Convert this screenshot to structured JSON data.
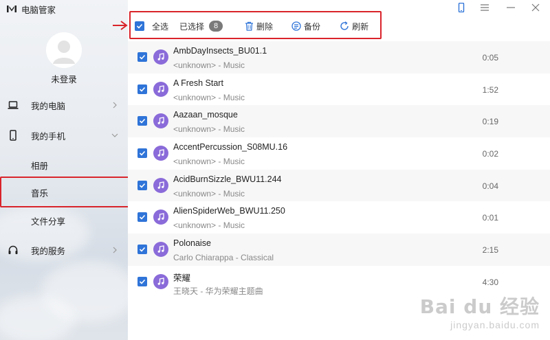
{
  "app": {
    "title": "电脑管家",
    "logo_icon": "app-logo-icon"
  },
  "user": {
    "login_status": "未登录"
  },
  "sidebar": {
    "items": [
      {
        "label": "我的电脑",
        "icon": "laptop-icon"
      },
      {
        "label": "我的手机",
        "icon": "phone-icon"
      },
      {
        "label": "相册"
      },
      {
        "label": "音乐"
      },
      {
        "label": "文件分享"
      },
      {
        "label": "我的服务",
        "icon": "headset-icon"
      }
    ],
    "selected": "音乐"
  },
  "toolbar": {
    "select_all": "全选",
    "selected_label": "已选择",
    "selected_count": "8",
    "delete": "删除",
    "backup": "备份",
    "refresh": "刷新"
  },
  "songs": [
    {
      "title": "AmbDayInsects_BU01.1",
      "subtitle": "<unknown> - Music",
      "duration": "0:05"
    },
    {
      "title": "A Fresh Start",
      "subtitle": "<unknown> - Music",
      "duration": "1:52"
    },
    {
      "title": "Aazaan_mosque",
      "subtitle": "<unknown> - Music",
      "duration": "0:19"
    },
    {
      "title": "AccentPercussion_S08MU.16",
      "subtitle": "<unknown> - Music",
      "duration": "0:02"
    },
    {
      "title": "AcidBurnSizzle_BWU11.244",
      "subtitle": "<unknown> - Music",
      "duration": "0:04"
    },
    {
      "title": "AlienSpiderWeb_BWU11.250",
      "subtitle": "<unknown> - Music",
      "duration": "0:01"
    },
    {
      "title": "Polonaise",
      "subtitle": "Carlo Chiarappa - Classical",
      "duration": "2:15"
    },
    {
      "title": "荣耀",
      "subtitle": "王晓天 - 华为荣耀主题曲",
      "duration": "4:30"
    }
  ],
  "watermark": {
    "logo": "Bai du 经验",
    "url": "jingyan.baidu.com"
  },
  "colors": {
    "accent": "#2f74d8",
    "highlight": "#d9232a",
    "music_icon": "#8a6bd9"
  }
}
